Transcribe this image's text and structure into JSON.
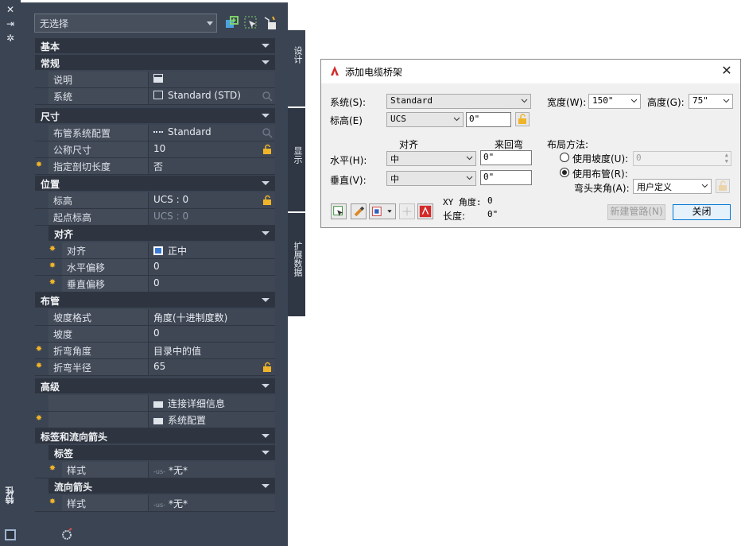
{
  "palette": {
    "title": "特性",
    "selector": {
      "value": "无选择"
    },
    "side_tabs": [
      "设计",
      "显示",
      "扩展数据"
    ],
    "sections": {
      "basic": "基本",
      "general": "常规",
      "dimensions": "尺寸",
      "location": "位置",
      "justification": "对齐",
      "routing": "布管",
      "advanced": "高级",
      "labels_flow": "标签和流向箭头",
      "labels": "标签",
      "flow_arrows": "流向箭头"
    },
    "rows": {
      "description": {
        "label": "说明",
        "value": ""
      },
      "system": {
        "label": "系统",
        "value": "Standard (STD)"
      },
      "routing_pref": {
        "label": "布管系统配置",
        "value": "Standard"
      },
      "nominal_size": {
        "label": "公称尺寸",
        "value": "10"
      },
      "cut_length": {
        "label": "指定剖切长度",
        "value": "否"
      },
      "elevation": {
        "label": "标高",
        "value": "UCS : 0"
      },
      "start_elevation": {
        "label": "起点标高",
        "value": "UCS : 0"
      },
      "justify": {
        "label": "对齐",
        "value": "正中"
      },
      "h_offset": {
        "label": "水平偏移",
        "value": "0"
      },
      "v_offset": {
        "label": "垂直偏移",
        "value": "0"
      },
      "slope_format": {
        "label": "坡度格式",
        "value": "角度(十进制度数)"
      },
      "slope": {
        "label": "坡度",
        "value": "0"
      },
      "bend_angle": {
        "label": "折弯角度",
        "value": "目录中的值"
      },
      "bend_radius": {
        "label": "折弯半径",
        "value": "65"
      },
      "connection_details": {
        "value": "连接详细信息"
      },
      "system_config": {
        "value": "系统配置"
      },
      "label_style": {
        "label": "样式",
        "value": "*无*",
        "prefix": "-us-"
      },
      "flow_style": {
        "label": "样式",
        "value": "*无*",
        "prefix": "-us-"
      }
    }
  },
  "dialog": {
    "title": "添加电缆桥架",
    "system_label": "系统(S):",
    "system_value": "Standard",
    "elevation_label": "标高(E)",
    "elevation_ref": "UCS",
    "elevation_value": "0\"",
    "width_label": "宽度(W):",
    "width_value": "150\"",
    "height_label": "高度(G):",
    "height_value": "75\"",
    "justify_header": "对齐",
    "riser_header": "来回弯",
    "horizontal_label": "水平(H):",
    "horizontal_value": "中",
    "horizontal_riser": "0\"",
    "vertical_label": "垂直(V):",
    "vertical_value": "中",
    "vertical_riser": "0\"",
    "layout_method_label": "布局方法:",
    "use_slope_label": "使用坡度(U):",
    "use_slope_value": "0",
    "use_routing_label": "使用布管(R):",
    "elbow_angle_label": "弯头夹角(A):",
    "elbow_angle_value": "用户定义",
    "xy_angle_label": "XY 角度:",
    "xy_angle_value": "0",
    "length_label": "长度:",
    "length_value": "0\"",
    "new_run_button": "新建管路(N)",
    "close_button": "关闭",
    "close_icon": "close-icon"
  },
  "colors": {
    "panel": "#3b4453",
    "section": "#2e3540",
    "accent_lock": "#f0b429",
    "primary_border": "#0078d7"
  }
}
